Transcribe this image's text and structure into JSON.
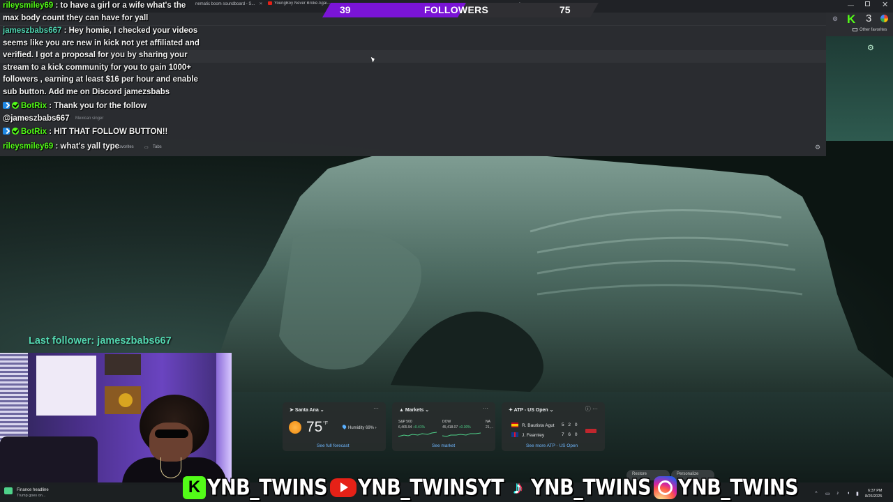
{
  "browser": {
    "tabs": [
      {
        "label": "nematic boom soundboard - S..."
      },
      {
        "label": "YoungBoy Never Broke Agai..."
      }
    ],
    "new_tab": "+",
    "other_favorites": "Other favorites",
    "notification_count": "3"
  },
  "favorites_bar": {
    "favorites": "Favorites",
    "tabs": "Tabs"
  },
  "chat": {
    "messages": [
      {
        "user": "rileysmiley69",
        "sep": " : ",
        "text": "to have a girl or a wife what's the max body count they can have for yall"
      },
      {
        "user": "jameszbabs667",
        "sep": " : ",
        "text": "Hey homie, I checked your videos seems like you are new in kick not yet affiliated and verified. I got a proposal for you by sharing your stream to a kick community for you to gain 1000+ followers , earning at least $16 per hour and enable sub button. Add me on Discord jamezsbabs"
      },
      {
        "user": "BotRix",
        "sep": " : ",
        "text": "Thank you for the follow @jameszbabs667"
      },
      {
        "user": "BotRix",
        "sep": " : ",
        "text": "HIT THAT FOLLOW BUTTON!!"
      },
      {
        "user": "rileysmiley69",
        "sep": " : ",
        "text": "what's yall type"
      }
    ],
    "mexican_singer": "Mexican singer"
  },
  "followers_goal": {
    "label": "FOLLOWERS",
    "current": 39,
    "goal": 75,
    "progress": 0.52
  },
  "last_follower": {
    "text": "Last follower: jameszbabs667"
  },
  "widgets": {
    "weather": {
      "location": "Santa Ana",
      "temp": "75",
      "unit": "°F",
      "humidity": "Humidity 69%",
      "link": "See full forecast"
    },
    "markets": {
      "title": "Markets",
      "items": [
        {
          "name": "S&P 500",
          "value": "6,465.94",
          "change": "+0.41%"
        },
        {
          "name": "DOW",
          "value": "45,418.07",
          "change": "+0.30%"
        },
        {
          "name": "NA",
          "value": "21,..."
        }
      ],
      "link": "See market"
    },
    "atp": {
      "title": "ATP - US Open",
      "players": [
        {
          "name": "R. Bautista Agut",
          "score": "5 2 0"
        },
        {
          "name": "J. Fearnley",
          "score": "7 6 0"
        }
      ],
      "link": "See more ATP - US Open"
    }
  },
  "taskbar": {
    "news_title": "Finance headline",
    "news_sub": "Trump goes on...",
    "time": "6:37 PM",
    "date": "8/26/2025",
    "btn_left": "Restore",
    "btn_right": "Personalize"
  },
  "social": {
    "kick": "YNB_TWINS",
    "youtube": "YNB_TWINSYT",
    "tiktok": "YNB_TWINS",
    "instagram": "YNB_TWINS"
  },
  "colors": {
    "kick_green": "#53fc18",
    "follow_purple": "#7a14d6",
    "last_follower": "#53d7b0"
  },
  "icons": [
    "kick-icon",
    "youtube-icon",
    "tiktok-icon",
    "instagram-icon",
    "gear-icon",
    "sun-icon",
    "humidity-icon",
    "flag-spain-icon",
    "flag-uk-icon"
  ]
}
